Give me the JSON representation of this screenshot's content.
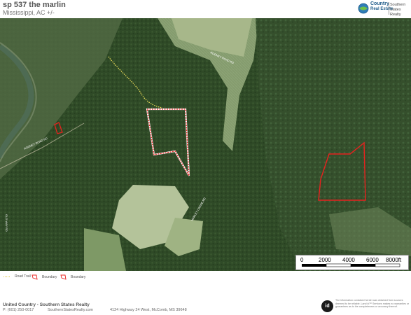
{
  "header": {
    "title": "sp 537 the marlin",
    "subtitle": "Mississippi,  AC +/-"
  },
  "logo": {
    "brand_line1": "Country",
    "brand_line2": "Real Estate",
    "brand_side": "Southern States Realty"
  },
  "map": {
    "road_labels": [
      "RODNEY ROAD RD",
      "RODNEY ROAD RD",
      "OLD WAY RD",
      "HARLEY CRANE RD"
    ],
    "scale_bar": {
      "ticks": [
        "0",
        "2000",
        "4000",
        "6000",
        "8000ft"
      ]
    },
    "colors": {
      "boundary": "#e8211e",
      "road_trail": "#f2e25a"
    }
  },
  "legend": {
    "items": [
      {
        "label": "Road Trail",
        "icon": "dotted-line-icon"
      },
      {
        "label": "Boundary",
        "icon": "boundary-shape-icon"
      },
      {
        "label": "Boundary",
        "icon": "boundary-shape-icon"
      }
    ]
  },
  "footer": {
    "company": "United Country - Southern States Realty",
    "phone": "P: (601) 250-0017",
    "email": "SouthernStatesRealty.com",
    "address": "4124 Highway 24 West, McComb, MS 39648",
    "id_logo": "id",
    "disclaimer": "The information contained herein was obtained from sources deemed to be reliable. Land id™ Services makes no warranties or guarantees as to the completeness or accuracy thereof."
  }
}
